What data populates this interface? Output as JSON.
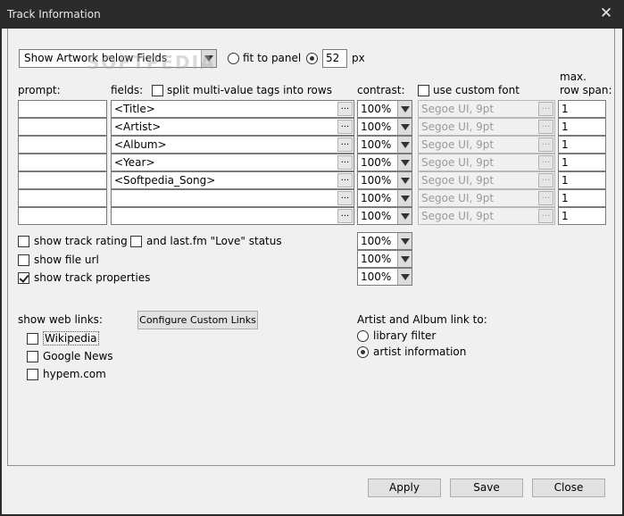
{
  "window": {
    "title": "Track Information",
    "close_glyph": "✕"
  },
  "artwork": {
    "mode_selected": "Show Artwork below Fields",
    "fit_to_panel_label": "fit to panel",
    "size_value": "52",
    "size_unit": "px"
  },
  "watermark": "SOFTPEDIA",
  "headers": {
    "prompt": "prompt:",
    "fields": "fields:",
    "split_label": "split multi-value tags into rows",
    "contrast": "contrast:",
    "custom_font_label": "use custom font",
    "max_row_span_1": "max.",
    "max_row_span_2": "row span:"
  },
  "rows": [
    {
      "prompt": "",
      "field": "<Title>",
      "contrast": "100%",
      "font": "Segoe UI, 9pt",
      "span": "1"
    },
    {
      "prompt": "",
      "field": "<Artist>",
      "contrast": "100%",
      "font": "Segoe UI, 9pt",
      "span": "1"
    },
    {
      "prompt": "",
      "field": "<Album>",
      "contrast": "100%",
      "font": "Segoe UI, 9pt",
      "span": "1"
    },
    {
      "prompt": "",
      "field": "<Year>",
      "contrast": "100%",
      "font": "Segoe UI, 9pt",
      "span": "1"
    },
    {
      "prompt": "",
      "field": "<Softpedia_Song>",
      "contrast": "100%",
      "font": "Segoe UI, 9pt",
      "span": "1"
    },
    {
      "prompt": "",
      "field": "",
      "contrast": "100%",
      "font": "Segoe UI, 9pt",
      "span": "1"
    },
    {
      "prompt": "",
      "field": "",
      "contrast": "100%",
      "font": "Segoe UI, 9pt",
      "span": "1"
    }
  ],
  "ellipsis": "...",
  "options": {
    "show_track_rating": "show track rating",
    "lastfm_love": "and last.fm \"Love\" status",
    "show_file_url": "show file url",
    "show_track_properties": "show track properties",
    "contrast_1": "100%",
    "contrast_2": "100%",
    "contrast_3": "100%"
  },
  "web_links": {
    "label": "show web links:",
    "configure_button": "Configure Custom Links",
    "items": [
      "Wikipedia",
      "Google News",
      "hypem.com"
    ]
  },
  "link_to": {
    "label": "Artist and Album link to:",
    "library_filter": "library filter",
    "artist_information": "artist information"
  },
  "buttons": {
    "apply": "Apply",
    "save": "Save",
    "close": "Close"
  }
}
